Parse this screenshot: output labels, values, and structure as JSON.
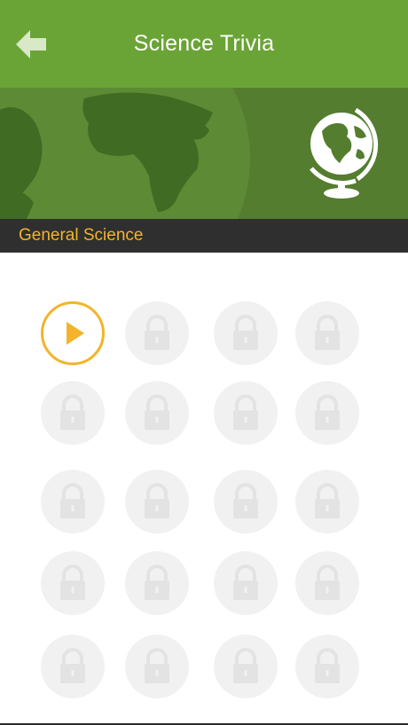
{
  "header": {
    "title": "Science Trivia",
    "back_icon": "back-arrow-icon",
    "background": "#6aa436"
  },
  "banner": {
    "image": "world-map-banner",
    "icon": "globe-icon",
    "background": "#547d2f"
  },
  "category": {
    "label": "General Science",
    "label_color": "#f3b42b",
    "background": "#2f2f2f"
  },
  "levels": {
    "accent": "#f3b42b",
    "items": [
      {
        "state": "current",
        "icon": "play-icon"
      },
      {
        "state": "locked",
        "icon": "lock-icon"
      },
      {
        "state": "locked",
        "icon": "lock-icon"
      },
      {
        "state": "locked",
        "icon": "lock-icon"
      },
      {
        "state": "locked",
        "icon": "lock-icon"
      },
      {
        "state": "locked",
        "icon": "lock-icon"
      },
      {
        "state": "locked",
        "icon": "lock-icon"
      },
      {
        "state": "locked",
        "icon": "lock-icon"
      },
      {
        "state": "locked",
        "icon": "lock-icon"
      },
      {
        "state": "locked",
        "icon": "lock-icon"
      },
      {
        "state": "locked",
        "icon": "lock-icon"
      },
      {
        "state": "locked",
        "icon": "lock-icon"
      },
      {
        "state": "locked",
        "icon": "lock-icon"
      },
      {
        "state": "locked",
        "icon": "lock-icon"
      },
      {
        "state": "locked",
        "icon": "lock-icon"
      },
      {
        "state": "locked",
        "icon": "lock-icon"
      },
      {
        "state": "locked",
        "icon": "lock-icon"
      },
      {
        "state": "locked",
        "icon": "lock-icon"
      },
      {
        "state": "locked",
        "icon": "lock-icon"
      },
      {
        "state": "locked",
        "icon": "lock-icon"
      }
    ]
  }
}
